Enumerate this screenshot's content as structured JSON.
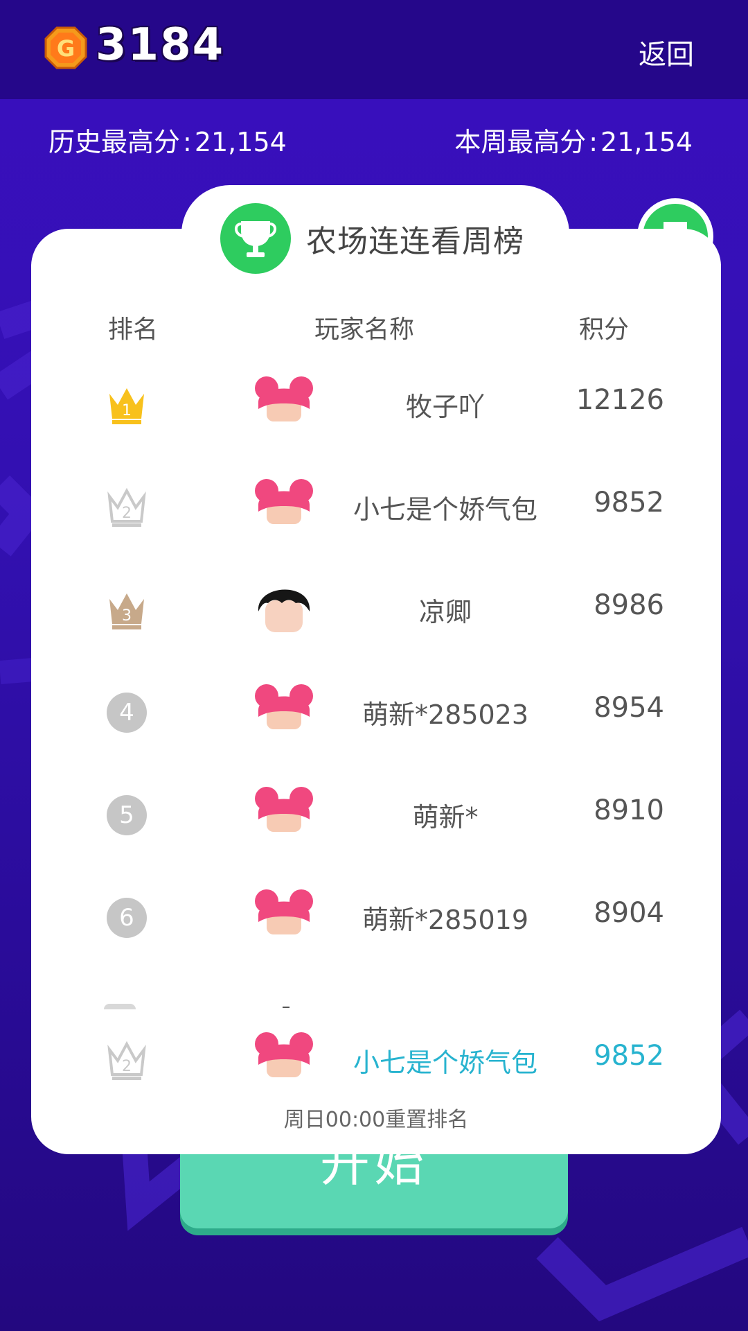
{
  "header": {
    "coin_icon": "gold-g-coin-icon",
    "coin_letter": "G",
    "coins": "3184",
    "back_label": "返回"
  },
  "scores": {
    "history_label": "历史最高分",
    "history_value": "21,154",
    "week_label": "本周最高分",
    "week_value": "21,154",
    "separator": ":"
  },
  "board": {
    "trophy_icon": "trophy-icon",
    "title": "农场连连看周榜",
    "columns": {
      "rank": "排名",
      "name": "玩家名称",
      "score": "积分"
    },
    "rows": [
      {
        "rank": "1",
        "rank_style": "gold-crown",
        "avatar": "pink-bun-hair-avatar",
        "name": "牧子吖",
        "score": "12126"
      },
      {
        "rank": "2",
        "rank_style": "silver-crown",
        "avatar": "pink-bun-hair-avatar",
        "name": "小七是个娇气包",
        "score": "9852"
      },
      {
        "rank": "3",
        "rank_style": "bronze-crown",
        "avatar": "black-hair-avatar",
        "name": "凉卿",
        "score": "8986"
      },
      {
        "rank": "4",
        "rank_style": "gray-circle",
        "avatar": "pink-bun-hair-avatar",
        "name": "萌新*285023",
        "score": "8954"
      },
      {
        "rank": "5",
        "rank_style": "gray-circle",
        "avatar": "pink-bun-hair-avatar",
        "name": "萌新*",
        "score": "8910"
      },
      {
        "rank": "6",
        "rank_style": "gray-circle",
        "avatar": "pink-bun-hair-avatar",
        "name": "萌新*285019",
        "score": "8904"
      }
    ],
    "self": {
      "rank": "2",
      "rank_style": "silver-crown",
      "avatar": "pink-bun-hair-avatar",
      "name": "小七是个娇气包",
      "score": "9852"
    },
    "footer_note": "周日00:00重置排名"
  },
  "start_button": {
    "label": "开始",
    "color": "#5ad7b3"
  },
  "colors": {
    "background": "#3210b0",
    "topbar": "#25078a",
    "trophy_green": "#2ecc5f",
    "self_highlight": "#27b3cf",
    "gold": "#f8c11c",
    "silver": "#c9c9c9",
    "bronze": "#c7a98a"
  }
}
